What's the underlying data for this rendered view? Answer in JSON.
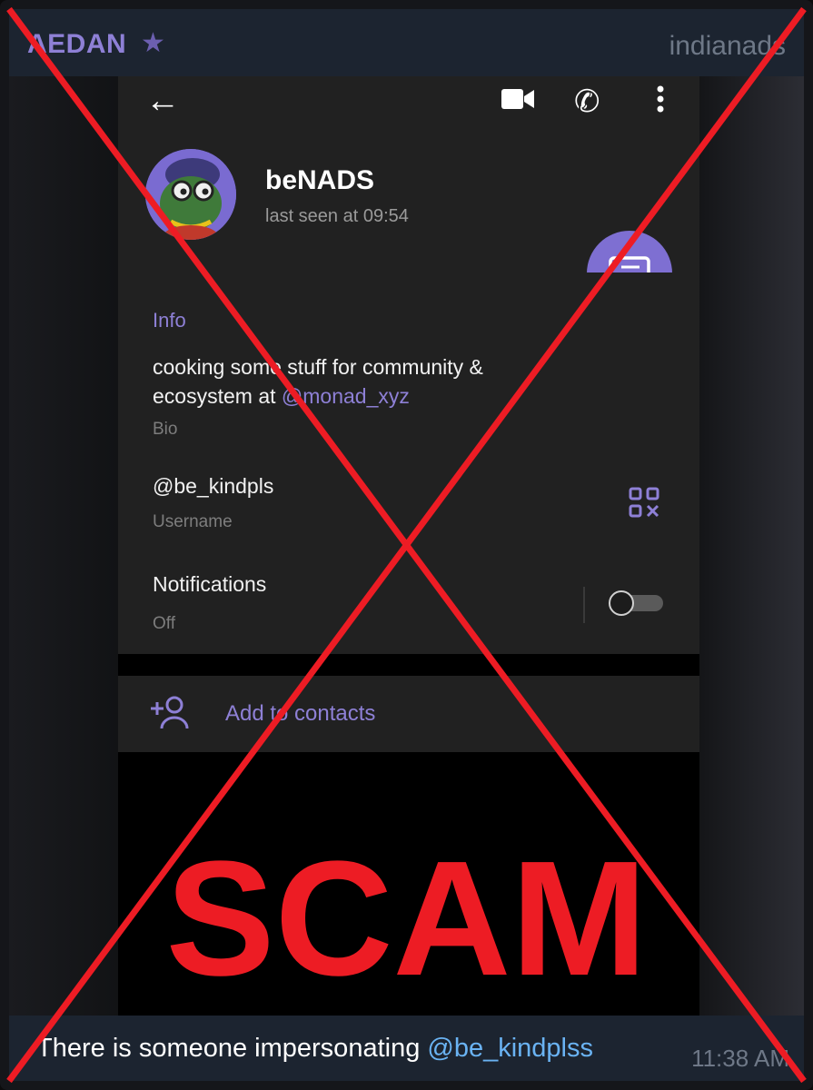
{
  "header": {
    "sender": "AEDAN",
    "channel": "indianads"
  },
  "profile": {
    "name": "beNADS",
    "last_seen": "last seen at 09:54",
    "info_title": "Info",
    "bio_text": "cooking some stuff for community & ecosystem at ",
    "bio_link": "@monad_xyz",
    "bio_label": "Bio",
    "username": "@be_kindpls",
    "username_label": "Username",
    "notifications": "Notifications",
    "notifications_state": "Off",
    "add_contacts": "Add to contacts"
  },
  "overlay": {
    "label": "SCAM",
    "color": "#ed1c24"
  },
  "message": {
    "text": "There is someone impersonating ",
    "mention": "@be_kindplss",
    "time": "11:38 AM"
  },
  "colors": {
    "accent": "#8e80d6",
    "mention": "#6ab3f3",
    "bar": "#1c2430"
  }
}
